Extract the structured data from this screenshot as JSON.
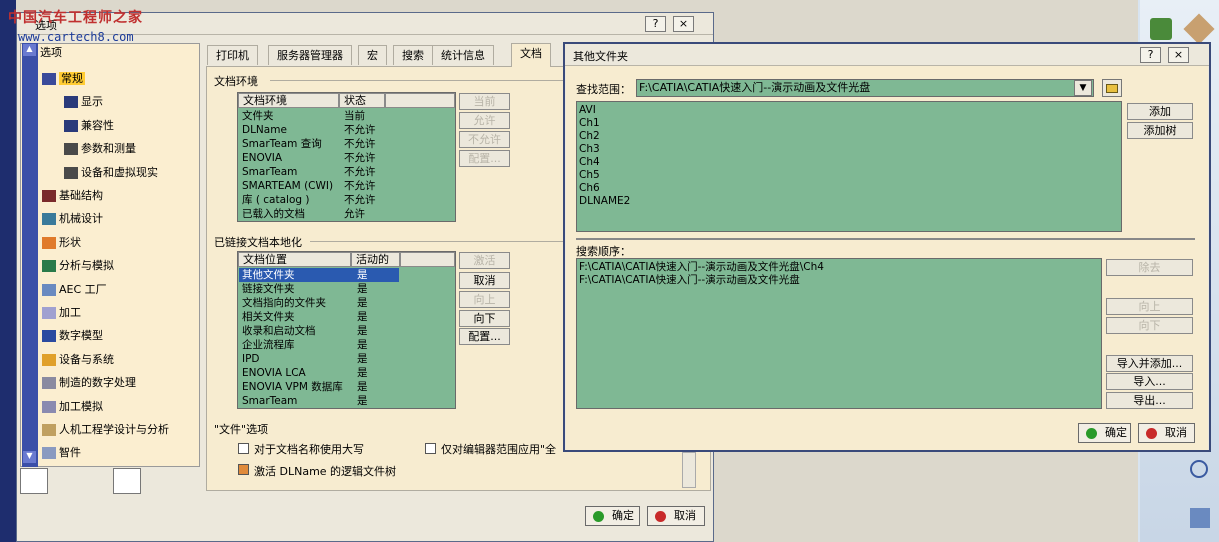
{
  "watermark": {
    "line1": "中国汽车工程师之家",
    "line2": "www.cartech8.com"
  },
  "options": {
    "title": "选项",
    "help": "?",
    "close": "×",
    "tree": [
      {
        "label": "选项",
        "color": "#000"
      },
      {
        "label": "常规",
        "color": "#c0303f"
      },
      {
        "label": "显示"
      },
      {
        "label": "兼容性"
      },
      {
        "label": "参数和测量"
      },
      {
        "label": "设备和虚拟现实"
      },
      {
        "label": "基础结构"
      },
      {
        "label": "机械设计"
      },
      {
        "label": "形状"
      },
      {
        "label": "分析与模拟"
      },
      {
        "label": "AEC 工厂"
      },
      {
        "label": "加工"
      },
      {
        "label": "数字模型"
      },
      {
        "label": "设备与系统"
      },
      {
        "label": "制造的数字处理"
      },
      {
        "label": "加工模拟"
      },
      {
        "label": "人机工程学设计与分析"
      },
      {
        "label": "智件"
      }
    ],
    "tabs": [
      "打印机",
      "服务器管理器",
      "宏",
      "搜索",
      "统计信息",
      "文档"
    ],
    "doc_env": {
      "section": "文档环境",
      "col1": "文档环境",
      "col2": "状态",
      "rows": [
        [
          "文件夹",
          "当前"
        ],
        [
          "DLName",
          "不允许"
        ],
        [
          "SmarTeam 查询",
          "不允许"
        ],
        [
          "ENOVIA",
          "不允许"
        ],
        [
          "SmarTeam",
          "不允许"
        ],
        [
          "SMARTEAM (CWI)",
          "不允许"
        ],
        [
          "库 ( catalog )",
          "不允许"
        ],
        [
          "已载入的文档",
          "允许"
        ]
      ],
      "buttons": [
        "当前",
        "允许",
        "不允许",
        "配置..."
      ]
    },
    "linked": {
      "section": "已链接文档本地化",
      "col1": "文档位置",
      "col2": "活动的",
      "rows": [
        [
          "其他文件夹",
          "是"
        ],
        [
          "链接文件夹",
          "是"
        ],
        [
          "文档指向的文件夹",
          "是"
        ],
        [
          "相关文件夹",
          "是"
        ],
        [
          "收录和启动文档",
          "是"
        ],
        [
          "企业流程库",
          "是"
        ],
        [
          "IPD",
          "是"
        ],
        [
          "ENOVIA LCA",
          "是"
        ],
        [
          "ENOVIA VPM 数据库",
          "是"
        ],
        [
          "SmarTeam",
          "是"
        ]
      ],
      "buttons": [
        "激活",
        "取消",
        "向上",
        "向下",
        "配置..."
      ]
    },
    "file_options": {
      "section": "\"文件\"选项",
      "chk1": "对于文档名称使用大写",
      "chk2": "仅对编辑器范围应用\"全",
      "chk3": "激活 DLName 的逻辑文件树"
    },
    "ok": "确定",
    "cancel": "取消"
  },
  "other": {
    "title": "其他文件夹",
    "help": "?",
    "close": "×",
    "lookin_label": "查找范围：",
    "lookin_value": "F:\\CATIA\\CATIA快速入门--演示动画及文件光盘",
    "folders": [
      "AVI",
      "Ch1",
      "Ch2",
      "Ch3",
      "Ch4",
      "Ch5",
      "Ch6",
      "DLNAME2"
    ],
    "add": "添加",
    "add_tree": "添加树",
    "search_label": "搜索顺序：",
    "search_list": [
      "F:\\CATIA\\CATIA快速入门--演示动画及文件光盘\\Ch4",
      "F:\\CATIA\\CATIA快速入门--演示动画及文件光盘"
    ],
    "remove": "除去",
    "up": "向上",
    "down": "向下",
    "import_add": "导入并添加...",
    "import": "导入...",
    "export": "导出...",
    "ok": "确定",
    "cancel": "取消"
  }
}
